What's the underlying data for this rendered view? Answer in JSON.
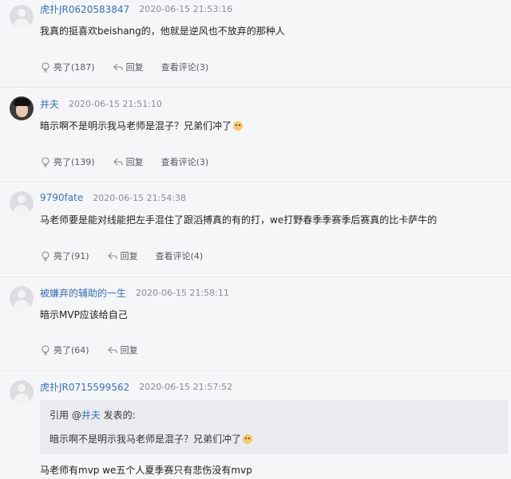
{
  "posts": [
    {
      "username": "虎扑JR0620583847",
      "time": "2020-06-15 21:53:16",
      "text": "我真的挺喜欢beishang的，他就是逆风也不放弃的那种人",
      "like_label": "亮了(187)",
      "reply_label": "回复",
      "view_label": "查看评论(3)",
      "avatar": "default-avatar"
    },
    {
      "username": "井夫",
      "time": "2020-06-15 21:51:10",
      "text": "暗示啊不是明示我马老师是混子？兄弟们冲了",
      "like_label": "亮了(139)",
      "reply_label": "回复",
      "view_label": "查看评论(3)",
      "avatar": "photo-avatar"
    },
    {
      "username": "9790fate",
      "time": "2020-06-15 21:54:38",
      "text": "马老师要是能对线能把左手混住了跟滔搏真的有的打，we打野春季季赛季后赛真的比卡萨牛的",
      "like_label": "亮了(91)",
      "reply_label": "回复",
      "view_label": "查看评论(4)",
      "avatar": "default-avatar"
    },
    {
      "username": "被嫌弃的辅助的一生",
      "time": "2020-06-15 21:58:11",
      "text": "暗示MVP应该给自己",
      "like_label": "亮了(64)",
      "reply_label": "回复",
      "avatar": "default-avatar"
    },
    {
      "username": "虎扑JR0715599562",
      "time": "2020-06-15 21:57:52",
      "quote_prefix": "引用 @",
      "quote_user": "井夫",
      "quote_suffix": " 发表的:",
      "quote_text": "暗示啊不是明示我马老师是混子？兄弟们冲了",
      "text": "马老师有mvp we五个人夏季赛只有悲伤没有mvp",
      "avatar": "default-avatar"
    }
  ],
  "colors": {
    "link": "#3b6fb6",
    "meta": "#8a8d92",
    "post_bg": "#f5f6f8",
    "quote_bg": "#e9ebee"
  },
  "icons": {
    "like": "light-bulb-icon",
    "reply": "reply-arrow-icon",
    "emoji": "dog-emoji-icon"
  }
}
